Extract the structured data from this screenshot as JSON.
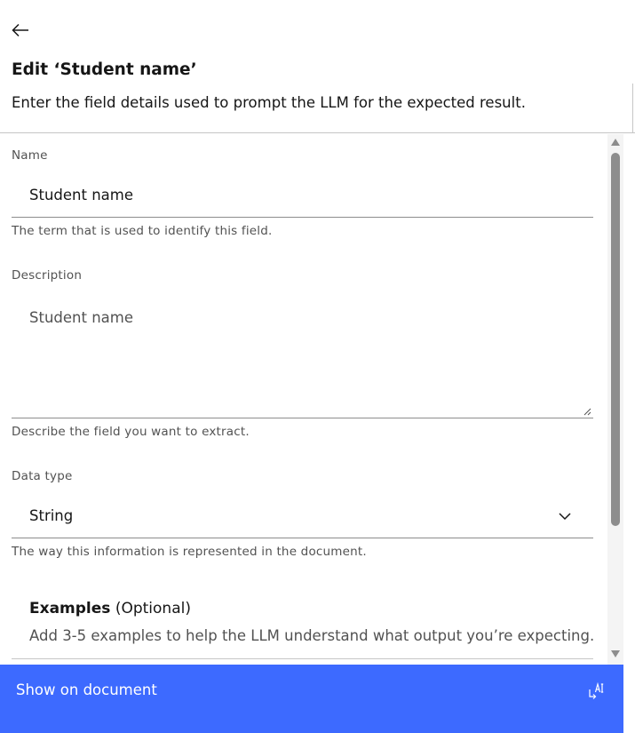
{
  "header": {
    "title": "Edit ‘Student name’",
    "subtitle": "Enter the field details used to prompt the LLM for the expected result."
  },
  "form": {
    "name": {
      "label": "Name",
      "value": "Student name",
      "helper": "The term that is used to identify this field."
    },
    "description": {
      "label": "Description",
      "placeholder": "Student name",
      "helper": "Describe the field you want to extract."
    },
    "data_type": {
      "label": "Data type",
      "value": "String",
      "helper": "The way this information is represented in the document."
    },
    "examples": {
      "label": "Examples",
      "optional": "(Optional)",
      "description": "Add 3-5 examples to help the LLM understand what output you’re expecting."
    }
  },
  "footer": {
    "button_label": "Show on document"
  },
  "icons": {
    "back": "arrow-left-icon",
    "chevron": "chevron-down-icon",
    "ai": "ai-icon"
  },
  "colors": {
    "primary": "#3d6aff",
    "text": "#161616",
    "secondary_text": "#525252"
  }
}
